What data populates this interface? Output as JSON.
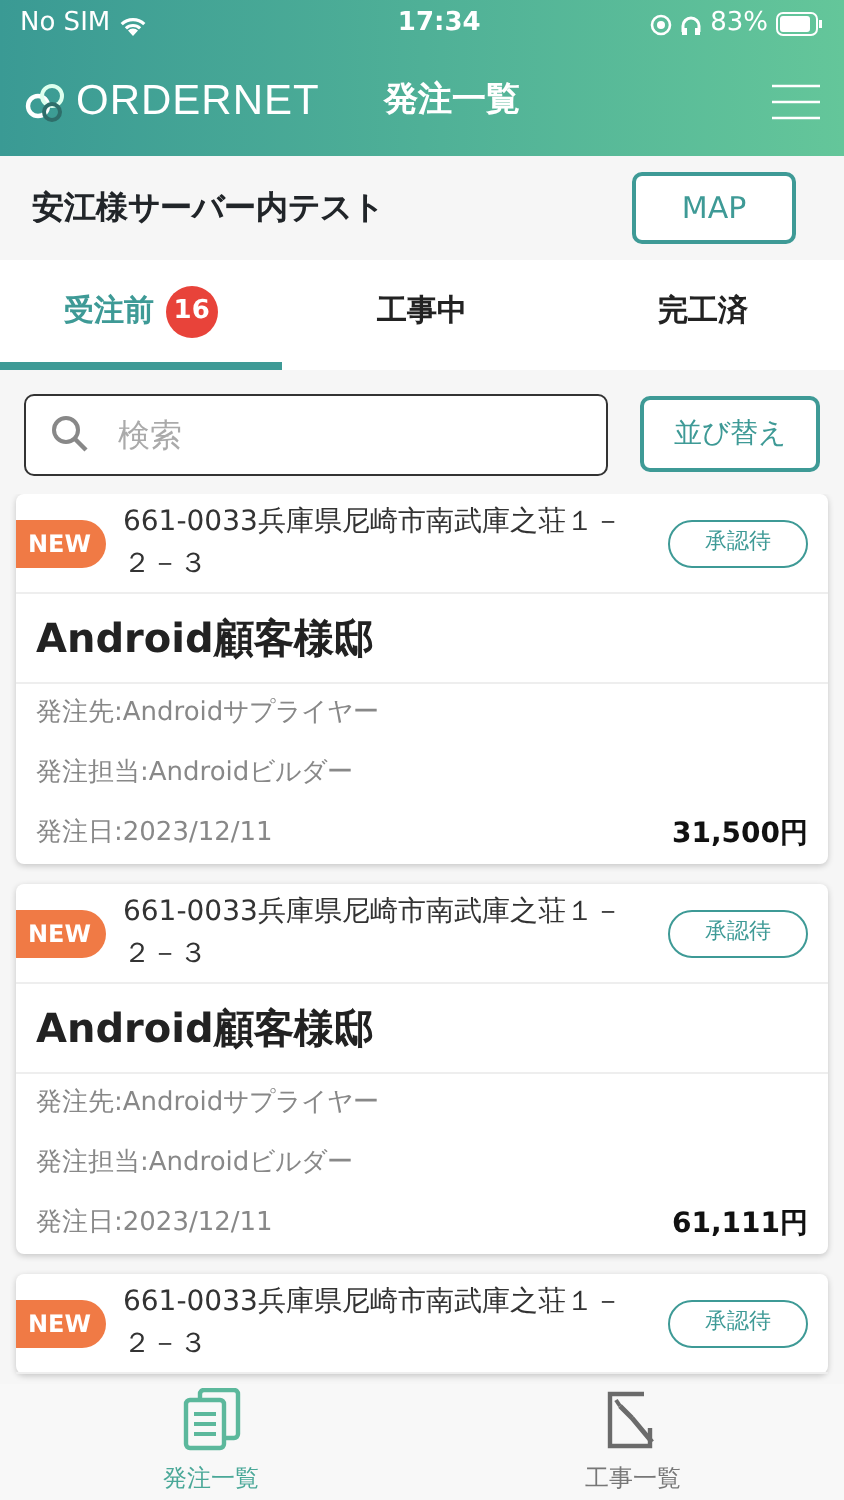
{
  "status_bar": {
    "carrier": "No SIM",
    "time": "17:34",
    "battery": "83%"
  },
  "header": {
    "logo": "ORDERNET",
    "title": "発注一覧"
  },
  "site": {
    "name": "安江様サーバー内テスト",
    "map_button": "MAP"
  },
  "tabs": [
    {
      "label": "受注前",
      "badge": "16",
      "selected": true
    },
    {
      "label": "工事中",
      "selected": false
    },
    {
      "label": "完工済",
      "selected": false
    }
  ],
  "search": {
    "placeholder": "検索"
  },
  "sort_button": "並び替え",
  "orders": [
    {
      "badge": "NEW",
      "address": "661-0033兵庫県尼崎市南武庫之荘１－２－３",
      "status": "承認待",
      "title": "Android顧客様邸",
      "supplier": "発注先:Androidサプライヤー",
      "person": "発注担当:Androidビルダー",
      "date": "発注日:2023/12/11",
      "amount": "31,500円"
    },
    {
      "badge": "NEW",
      "address": "661-0033兵庫県尼崎市南武庫之荘１－２－３",
      "status": "承認待",
      "title": "Android顧客様邸",
      "supplier": "発注先:Androidサプライヤー",
      "person": "発注担当:Androidビルダー",
      "date": "発注日:2023/12/11",
      "amount": "61,111円"
    },
    {
      "badge": "NEW",
      "address": "661-0033兵庫県尼崎市南武庫之荘１－２－３",
      "status": "承認待"
    }
  ],
  "bottom_nav": [
    {
      "label": "発注一覧",
      "selected": true
    },
    {
      "label": "工事一覧",
      "selected": false
    }
  ]
}
